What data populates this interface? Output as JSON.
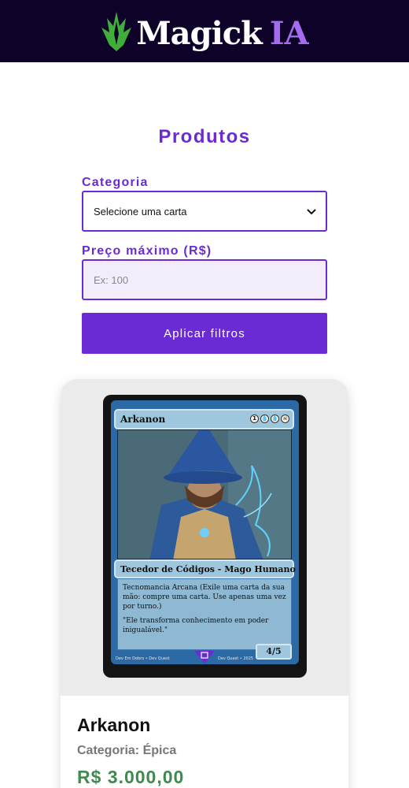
{
  "header": {
    "logo_text": "Magick",
    "logo_accent": "IA",
    "logo_icon": "green-crown-icon"
  },
  "main": {
    "title": "Produtos"
  },
  "filters": {
    "category_label": "Categoria",
    "category_selected": "Selecione uma carta",
    "price_label": "Preço máximo (R$)",
    "price_placeholder": "Ex: 100",
    "apply_label": "Aplicar filtros"
  },
  "products": [
    {
      "card": {
        "name": "Arkanon",
        "mana": [
          "1",
          "💧",
          "💧",
          "☠"
        ],
        "type_line": "Tecedor de Códigos - Mago Humano",
        "ability": "Tecnomancia Arcana (Exile uma carta da sua mão: compre uma carta. Use apenas uma vez por turno.)",
        "flavor": "\"Ele transforma conhecimento em poder inigualável.\"",
        "power_toughness": "4/5",
        "footer_left": "Dev Em Dobro • Dev Quest",
        "footer_right": "Dev Quest • 2025"
      },
      "name": "Arkanon",
      "category": "Categoria: Épica",
      "price": "R$ 3.000,00"
    }
  ],
  "colors": {
    "header_bg": "#0f0228",
    "accent": "#6a2bd4",
    "price": "#3f8a4e",
    "logo_green": "#3fae3a",
    "logo_ia": "#a56cf0"
  }
}
